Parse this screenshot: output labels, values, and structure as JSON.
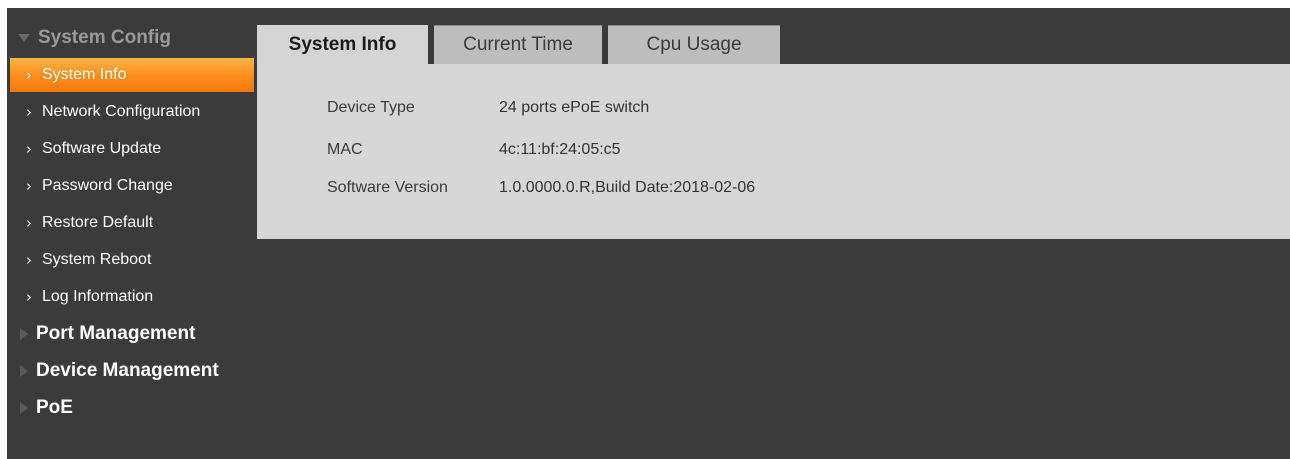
{
  "sidebar": {
    "groups": [
      {
        "label": "System Config",
        "expanded": true,
        "items": [
          {
            "label": "System Info",
            "active": true
          },
          {
            "label": "Network Configuration"
          },
          {
            "label": "Software Update"
          },
          {
            "label": "Password Change"
          },
          {
            "label": "Restore Default"
          },
          {
            "label": "System Reboot"
          },
          {
            "label": "Log Information"
          }
        ]
      },
      {
        "label": "Port Management",
        "expanded": false
      },
      {
        "label": "Device Management",
        "expanded": false
      },
      {
        "label": "PoE",
        "expanded": false
      }
    ]
  },
  "tabs": [
    {
      "label": "System Info",
      "active": true
    },
    {
      "label": "Current Time"
    },
    {
      "label": "Cpu Usage"
    }
  ],
  "info": {
    "device_type": {
      "label": "Device Type",
      "value": "24 ports ePoE switch"
    },
    "mac": {
      "label": "MAC",
      "value": "4c:11:bf:24:05:c5"
    },
    "software_version": {
      "label": "Software Version",
      "value": "1.0.0000.0.R,Build Date:2018-02-06"
    }
  },
  "colors": {
    "background": "#3b3b3b",
    "accent": "#ff8c1a",
    "panel": "#d6d6d6"
  },
  "icons": {
    "expanded_group": "caret-down-icon",
    "collapsed_group": "caret-right-icon",
    "sub_item": "chevron-right-icon"
  }
}
